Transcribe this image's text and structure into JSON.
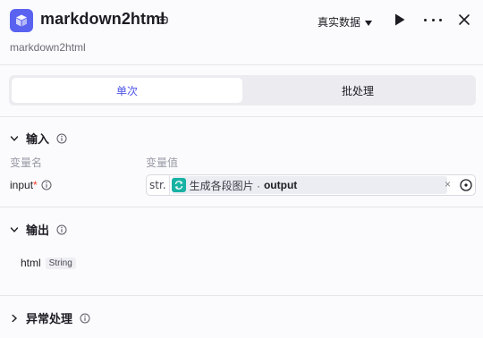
{
  "header": {
    "title": "markdown2html",
    "subtitle": "markdown2html",
    "mode_label": "真实数据",
    "icons": {
      "app": "cube-icon",
      "edit": "edit-icon",
      "run": "play-icon",
      "more": "more-icon",
      "close": "close-icon"
    },
    "accent_color": "#5a63f0"
  },
  "tabs": [
    {
      "label": "单次",
      "active": true
    },
    {
      "label": "批处理",
      "active": false
    }
  ],
  "input_section": {
    "title": "输入",
    "col_name": "变量名",
    "col_value": "变量值",
    "row": {
      "name": "input",
      "required_mark": "*",
      "type": "str.",
      "ref_node": "生成各段图片 ·",
      "ref_field": "output",
      "clear_glyph": "×"
    }
  },
  "output_section": {
    "title": "输出",
    "row": {
      "name": "html",
      "type": "String"
    }
  },
  "exception_section": {
    "title": "异常处理"
  }
}
